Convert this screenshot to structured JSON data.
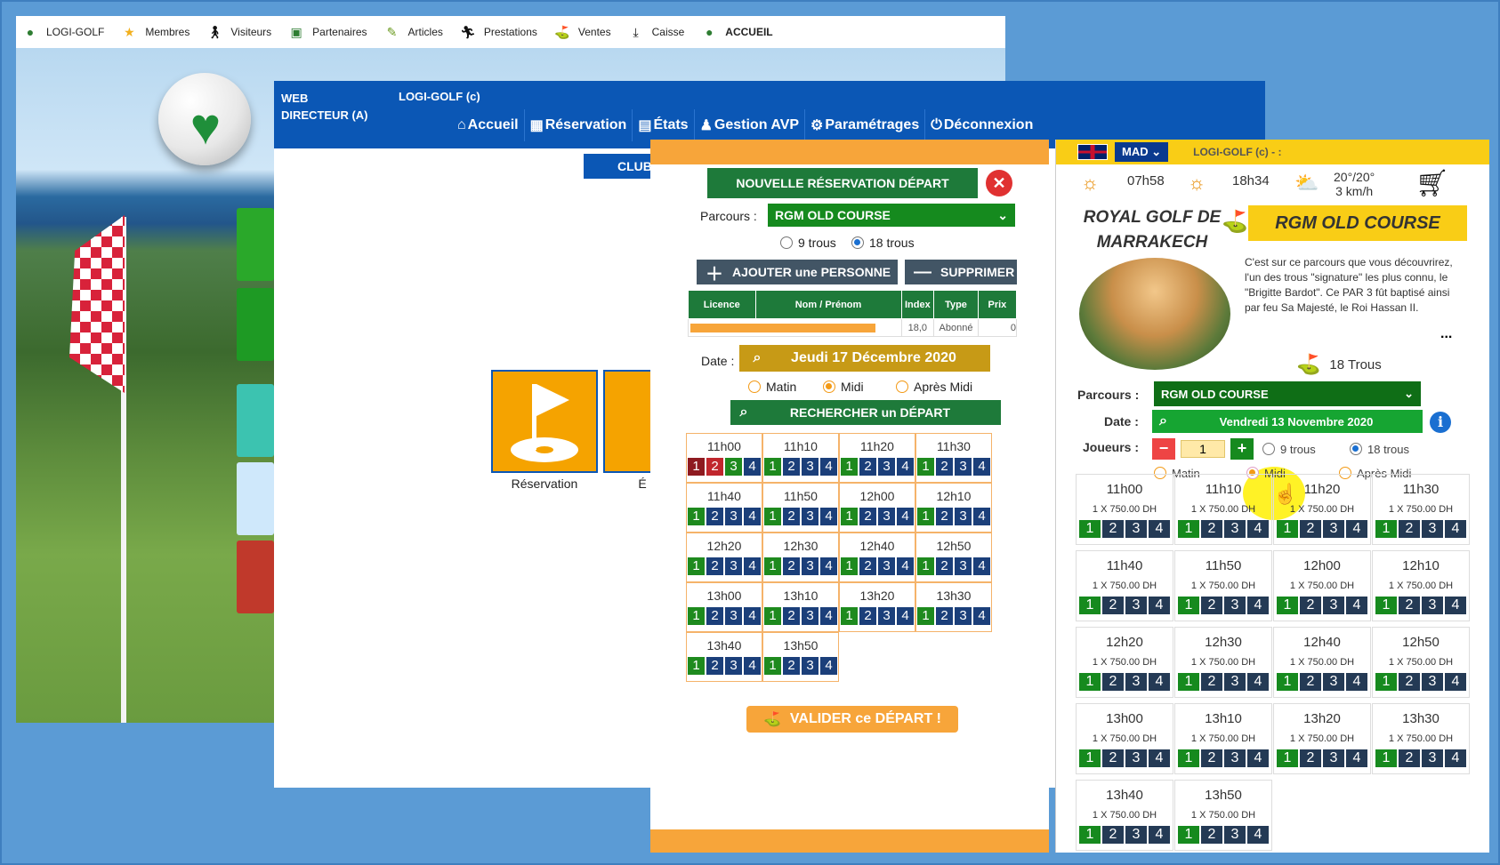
{
  "desktop": {
    "menu": [
      {
        "icon": "golf-ball-icon",
        "label": "LOGI-GOLF",
        "bold": false
      },
      {
        "icon": "star-icon",
        "label": "Membres",
        "bold": false
      },
      {
        "icon": "walker-icon",
        "label": "Visiteurs",
        "bold": false
      },
      {
        "icon": "partner-icon",
        "label": "Partenaires",
        "bold": false
      },
      {
        "icon": "pencil-icon",
        "label": "Articles",
        "bold": false
      },
      {
        "icon": "runner-icon",
        "label": "Prestations",
        "bold": false
      },
      {
        "icon": "green-icon",
        "label": "Ventes",
        "bold": false
      },
      {
        "icon": "download-icon",
        "label": "Caisse",
        "bold": false
      },
      {
        "icon": "golf-ball-icon",
        "label": "ACCUEIL",
        "bold": true
      }
    ]
  },
  "web": {
    "role_line1": "WEB",
    "role_line2": "DIRECTEUR (A)",
    "brand": "LOGI-GOLF (c)",
    "nav": [
      {
        "icon": "home-icon",
        "label": "Accueil"
      },
      {
        "icon": "calendar-icon",
        "label": "Réservation"
      },
      {
        "icon": "document-icon",
        "label": "États"
      },
      {
        "icon": "users-icon",
        "label": "Gestion AVP"
      },
      {
        "icon": "gear-icon",
        "label": "Paramétrages"
      },
      {
        "icon": "logout-icon",
        "label": "Déconnexion"
      }
    ],
    "club_label": "CLUB",
    "tile_reservation": "Réservation",
    "tile_etats": "É"
  },
  "reservation": {
    "title": "NOUVELLE RÉSERVATION DÉPART",
    "parcours_label": "Parcours :",
    "parcours_value": "RGM OLD COURSE",
    "holes_9": "9 trous",
    "holes_18": "18 trous",
    "add_person": "AJOUTER une PERSONNE",
    "remove": "SUPPRIMER",
    "table_headers": [
      "Licence",
      "Nom / Prénom",
      "Index",
      "Type",
      "Prix"
    ],
    "table_row": {
      "index": "18,0",
      "type": "Abonné",
      "prix": "0"
    },
    "date_label": "Date :",
    "date_value": "Jeudi 17 Décembre 2020",
    "period_matin": "Matin",
    "period_midi": "Midi",
    "period_apres": "Après Midi",
    "search_button": "RECHERCHER un DÉPART",
    "slots": [
      {
        "time": "11h00",
        "seats": [
          "maroon",
          "red",
          "green",
          "blue"
        ]
      },
      {
        "time": "11h10",
        "seats": [
          "green",
          "blue",
          "blue",
          "blue"
        ]
      },
      {
        "time": "11h20",
        "seats": [
          "green",
          "blue",
          "blue",
          "blue"
        ]
      },
      {
        "time": "11h30",
        "seats": [
          "green",
          "blue",
          "blue",
          "blue"
        ]
      },
      {
        "time": "11h40",
        "seats": [
          "green",
          "blue",
          "blue",
          "blue"
        ]
      },
      {
        "time": "11h50",
        "seats": [
          "green",
          "blue",
          "blue",
          "blue"
        ]
      },
      {
        "time": "12h00",
        "seats": [
          "green",
          "blue",
          "blue",
          "blue"
        ]
      },
      {
        "time": "12h10",
        "seats": [
          "green",
          "blue",
          "blue",
          "blue"
        ]
      },
      {
        "time": "12h20",
        "seats": [
          "green",
          "blue",
          "blue",
          "blue"
        ]
      },
      {
        "time": "12h30",
        "seats": [
          "green",
          "blue",
          "blue",
          "blue"
        ]
      },
      {
        "time": "12h40",
        "seats": [
          "green",
          "blue",
          "blue",
          "blue"
        ]
      },
      {
        "time": "12h50",
        "seats": [
          "green",
          "blue",
          "blue",
          "blue"
        ]
      },
      {
        "time": "13h00",
        "seats": [
          "green",
          "blue",
          "blue",
          "blue"
        ]
      },
      {
        "time": "13h10",
        "seats": [
          "green",
          "blue",
          "blue",
          "blue"
        ]
      },
      {
        "time": "13h20",
        "seats": [
          "green",
          "blue",
          "blue",
          "blue"
        ]
      },
      {
        "time": "13h30",
        "seats": [
          "green",
          "blue",
          "blue",
          "blue"
        ]
      },
      {
        "time": "13h40",
        "seats": [
          "green",
          "blue",
          "blue",
          "blue"
        ]
      },
      {
        "time": "13h50",
        "seats": [
          "green",
          "blue",
          "blue",
          "blue"
        ]
      }
    ],
    "validate": "VALIDER ce DÉPART !"
  },
  "mobile": {
    "currency": "MAD",
    "title": "LOGI-GOLF (c) - :",
    "sunrise": "07h58",
    "sunset": "18h34",
    "temp": "20°/20°",
    "wind": "3 km/h",
    "club_name_line1": "ROYAL GOLF DE",
    "club_name_line2": "MARRAKECH",
    "course_name": "RGM OLD COURSE",
    "description": "C'est sur ce parcours que vous découvrirez, l'un des trous \"signature\" les plus connu, le \"Brigitte Bardot\". Ce PAR 3 fût baptisé ainsi par feu Sa Majesté, le Roi Hassan II.",
    "more": "...",
    "holes": "18 Trous",
    "parcours_label": "Parcours :",
    "parcours_value": "RGM OLD COURSE",
    "date_label": "Date :",
    "date_value": "Vendredi 13 Novembre 2020",
    "players_label": "Joueurs :",
    "players_value": "1",
    "holes_9": "9 trous",
    "holes_18": "18 trous",
    "period_matin": "Matin",
    "period_midi": "Midi",
    "period_apres": "Après Midi",
    "slots": [
      {
        "time": "11h00",
        "price": "1 X 750.00 DH"
      },
      {
        "time": "11h10",
        "price": "1 X 750.00 DH"
      },
      {
        "time": "11h20",
        "price": "1 X 750.00 DH"
      },
      {
        "time": "11h30",
        "price": "1 X 750.00 DH"
      },
      {
        "time": "11h40",
        "price": "1 X 750.00 DH"
      },
      {
        "time": "11h50",
        "price": "1 X 750.00 DH"
      },
      {
        "time": "12h00",
        "price": "1 X 750.00 DH"
      },
      {
        "time": "12h10",
        "price": "1 X 750.00 DH"
      },
      {
        "time": "12h20",
        "price": "1 X 750.00 DH"
      },
      {
        "time": "12h30",
        "price": "1 X 750.00 DH"
      },
      {
        "time": "12h40",
        "price": "1 X 750.00 DH"
      },
      {
        "time": "12h50",
        "price": "1 X 750.00 DH"
      },
      {
        "time": "13h00",
        "price": "1 X 750.00 DH"
      },
      {
        "time": "13h10",
        "price": "1 X 750.00 DH"
      },
      {
        "time": "13h20",
        "price": "1 X 750.00 DH"
      },
      {
        "time": "13h30",
        "price": "1 X 750.00 DH"
      },
      {
        "time": "13h40",
        "price": "1 X 750.00 DH"
      },
      {
        "time": "13h50",
        "price": "1 X 750.00 DH"
      }
    ]
  },
  "colors": {
    "brand_blue": "#0b57b5",
    "accent_orange": "#f7a53a",
    "green": "#1e7a3a",
    "yellow": "#f9cd16"
  }
}
